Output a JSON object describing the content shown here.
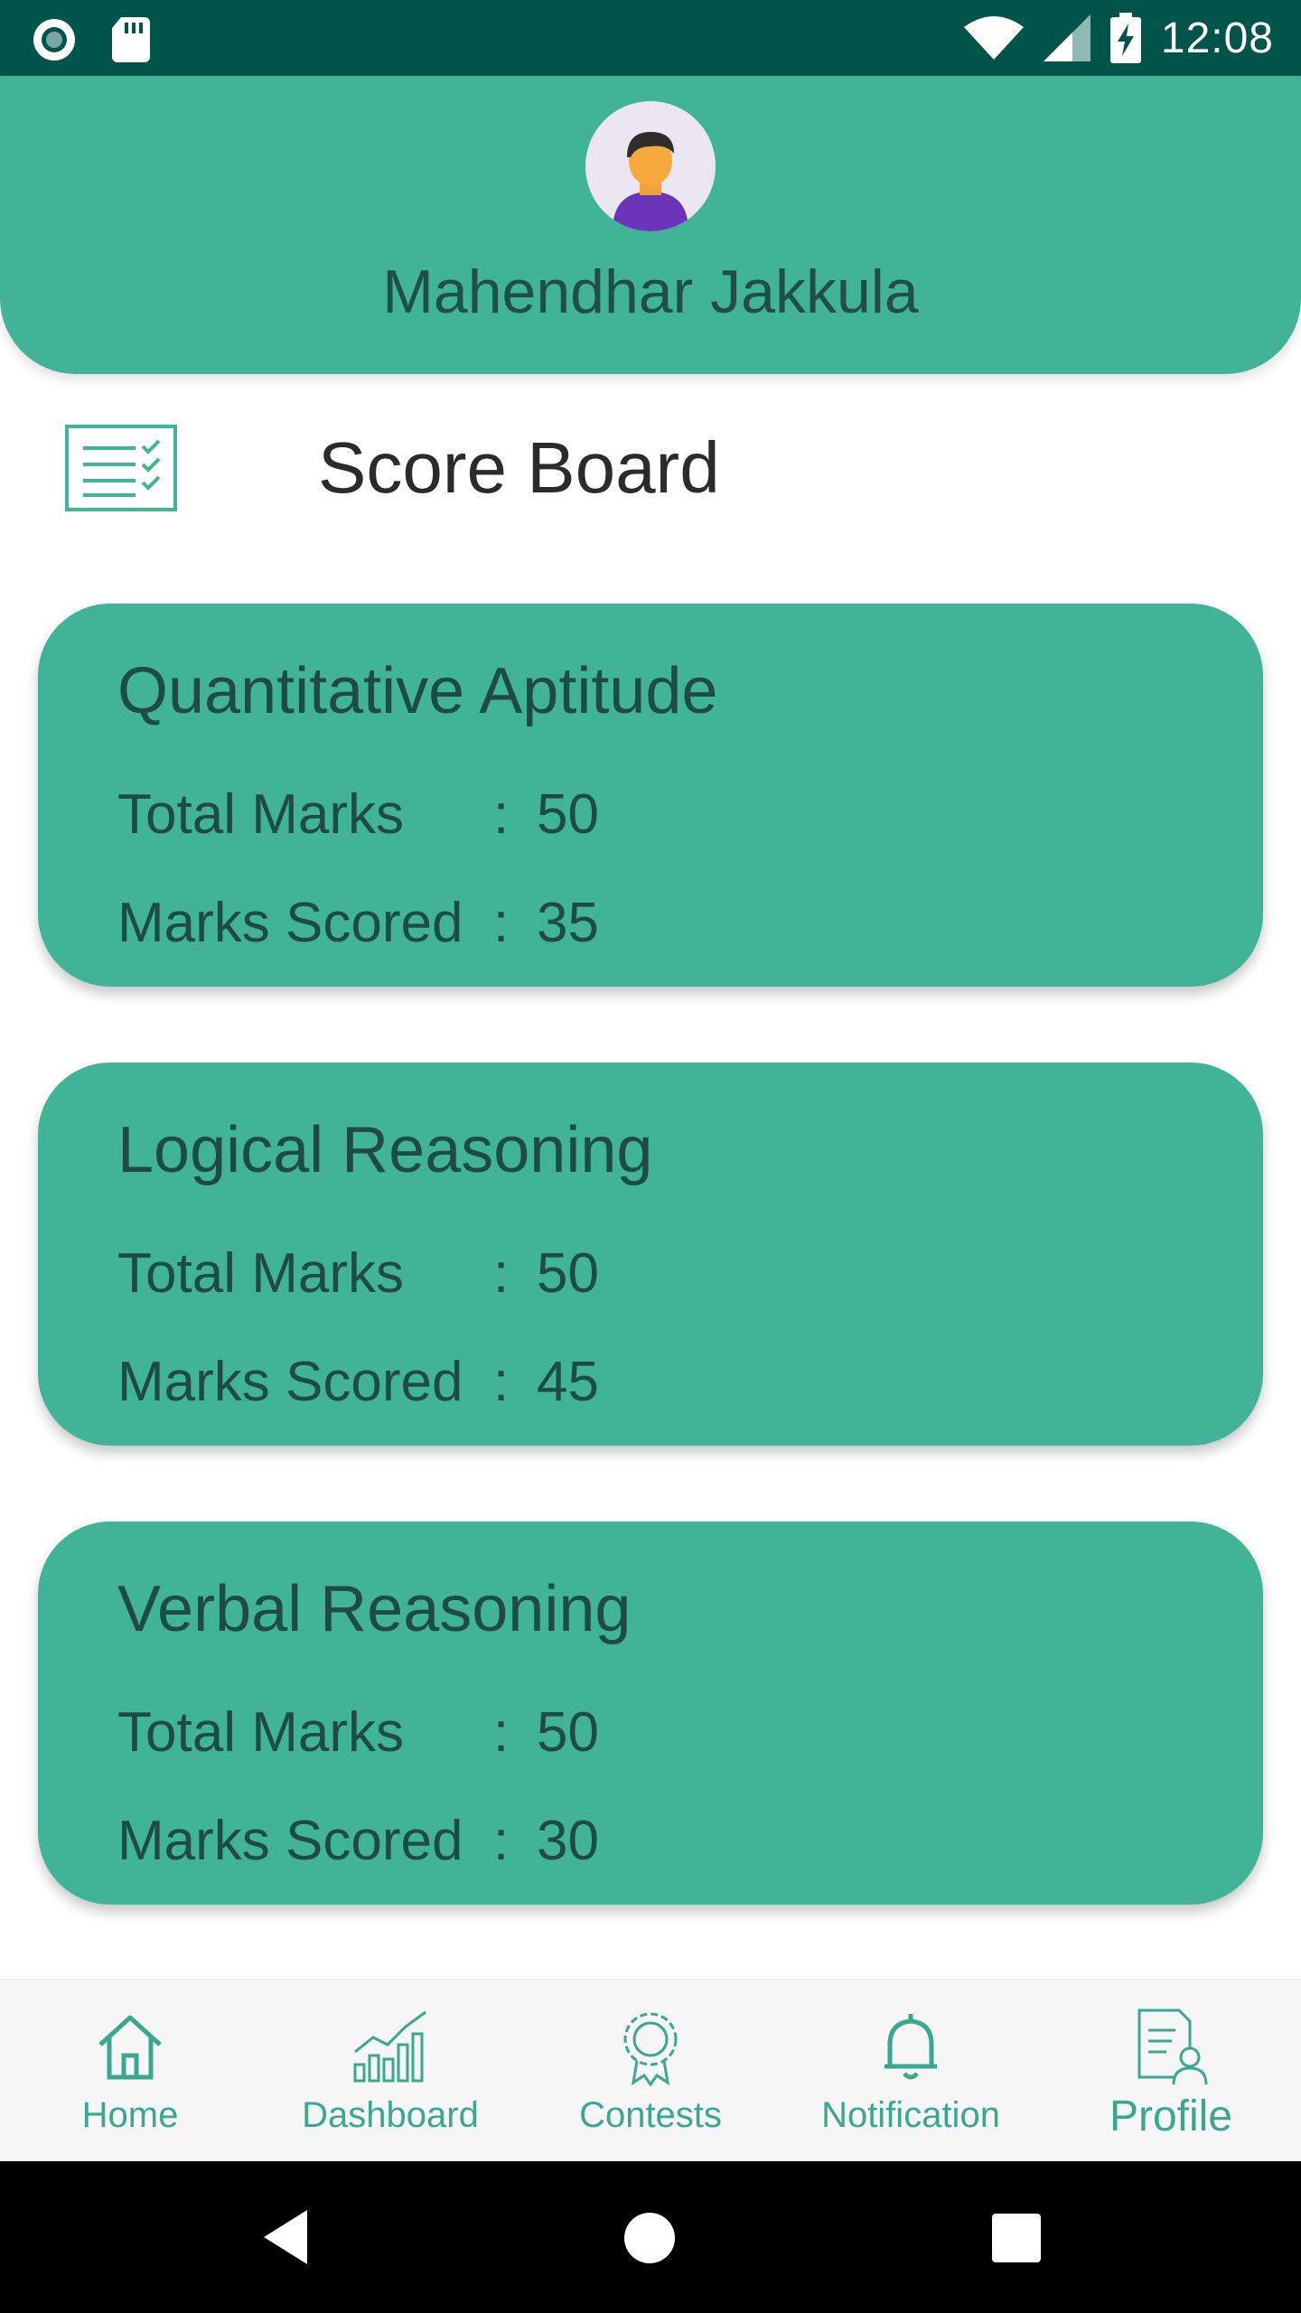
{
  "status_bar": {
    "time": "12:08",
    "icons": [
      "record-icon",
      "sd-card-icon",
      "wifi-icon",
      "signal-icon",
      "battery-charging-icon"
    ]
  },
  "header": {
    "avatar_icon": "user-avatar-icon",
    "user_name": "Mahendhar Jakkula"
  },
  "section": {
    "title": "Score Board",
    "icon": "scoreboard-checklist-icon"
  },
  "scores": [
    {
      "subject": "Quantitative Aptitude",
      "total_label": "Total Marks",
      "total_sep": ":",
      "total_value": "50",
      "scored_label": "Marks Scored",
      "scored_sep": ":",
      "scored_value": "35"
    },
    {
      "subject": "Logical Reasoning",
      "total_label": "Total Marks",
      "total_sep": ":",
      "total_value": "50",
      "scored_label": "Marks Scored",
      "scored_sep": ":",
      "scored_value": "45"
    },
    {
      "subject": "Verbal Reasoning",
      "total_label": "Total Marks",
      "total_sep": ":",
      "total_value": "50",
      "scored_label": "Marks Scored",
      "scored_sep": ":",
      "scored_value": "30"
    }
  ],
  "bottom_nav": {
    "items": [
      {
        "label": "Home",
        "icon": "home-icon"
      },
      {
        "label": "Dashboard",
        "icon": "dashboard-chart-icon"
      },
      {
        "label": "Contests",
        "icon": "contests-badge-icon"
      },
      {
        "label": "Notification",
        "icon": "bell-icon"
      },
      {
        "label": "Profile",
        "icon": "profile-document-icon"
      }
    ],
    "active": "Profile"
  },
  "system_nav": {
    "buttons": [
      "back-icon",
      "home-circle-icon",
      "recents-icon"
    ]
  },
  "colors": {
    "status_bar": "#00544a",
    "primary": "#41b497",
    "card_text": "#1e4b43",
    "nav_accent": "#3aa88c"
  }
}
